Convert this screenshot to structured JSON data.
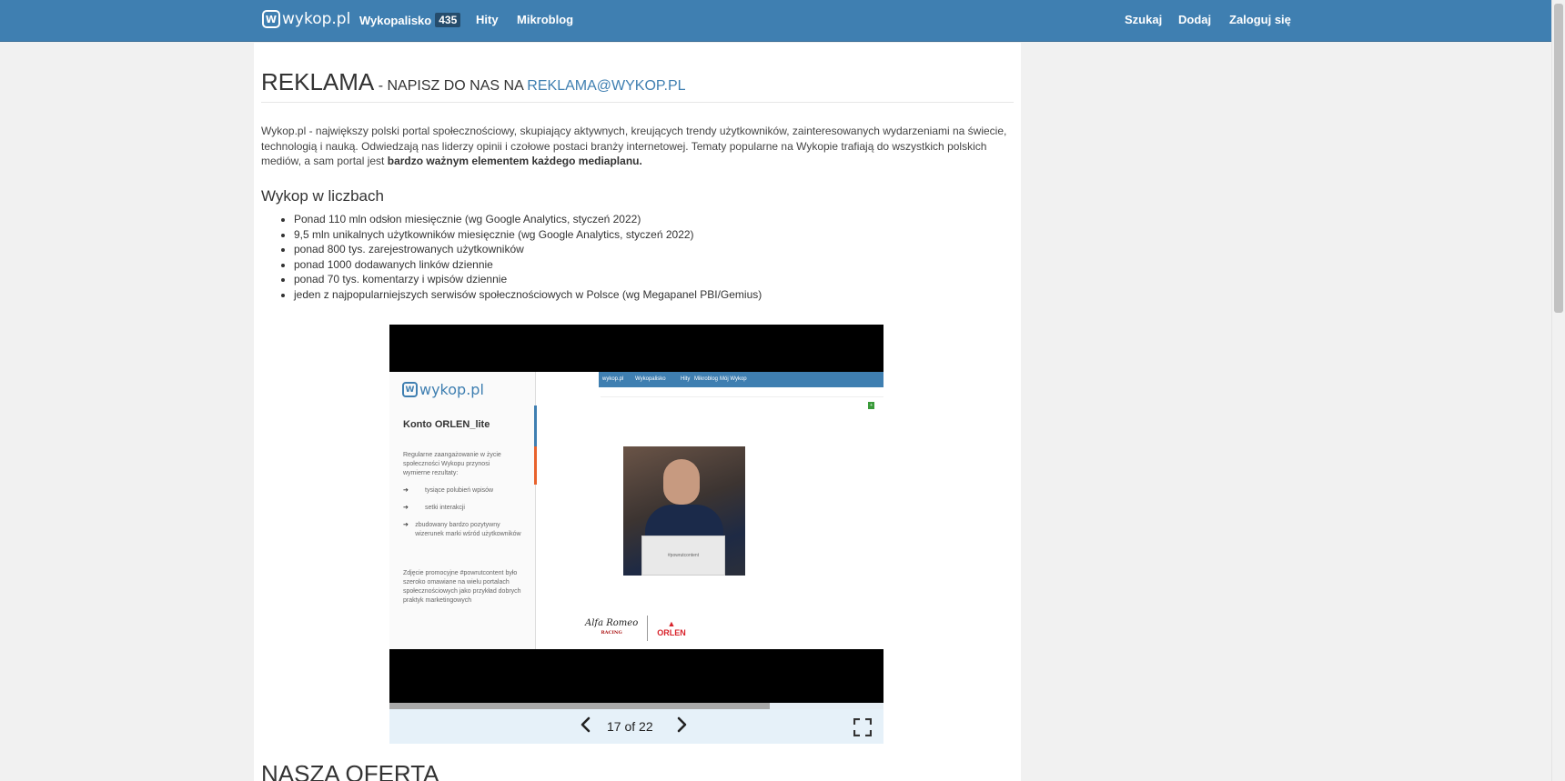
{
  "header": {
    "logo_text": "wykop.pl",
    "logo_mark": "W",
    "nav": {
      "wykopalisko": "Wykopalisko",
      "wykopalisko_count": "435",
      "hity": "Hity",
      "mikroblog": "Mikroblog",
      "szukaj": "Szukaj",
      "dodaj": "Dodaj",
      "zaloguj": "Zaloguj się"
    }
  },
  "page": {
    "title_main": "REKLAMA",
    "title_sub": " - NAPISZ DO NAS NA ",
    "title_email": "REKLAMA@WYKOP.PL",
    "intro_text": "Wykop.pl - największy polski portal społecznościowy, skupiający aktywnych, kreujących trendy użytkowników, zainteresowanych wydarzeniami na świecie, technologią i nauką. Odwiedzają nas liderzy opinii i czołowe postaci branży internetowej. Tematy popularne na Wykopie trafiają do wszystkich polskich mediów, a sam portal jest ",
    "intro_bold": "bardzo ważnym elementem każdego mediaplanu.",
    "stats_heading": "Wykop w liczbach",
    "stats": [
      "Ponad 110 mln odsłon miesięcznie (wg Google Analytics, styczeń 2022)",
      "9,5 mln unikalnych użytkowników miesięcznie (wg Google Analytics, styczeń 2022)",
      "ponad 800 tys. zarejestrowanych użytkowników",
      "ponad 1000 dodawanych linków dziennie",
      "ponad 70 tys. komentarzy i wpisów dziennie",
      "jeden z najpopularniejszych serwisów społecznościowych w Polsce (wg Megapanel PBI/Gemius)"
    ],
    "offer_heading": "NASZA OFERTA"
  },
  "slideshow": {
    "current": 17,
    "total": 22,
    "counter_text": "17 of 22",
    "progress_fraction": 0.77,
    "prev_icon": "chevron-left-icon",
    "next_icon": "chevron-right-icon",
    "fullscreen_icon": "fullscreen-icon",
    "slide": {
      "logo_text": "wykop.pl",
      "title": "Konto ORLEN_lite",
      "description": "Regularne zaangażowanie w życie społeczności Wykopu przynosi wymierne rezultaty:",
      "bullets": [
        "tysiące polubień wpisów",
        "setki interakcji",
        "zbudowany bardzo pozytywny wizerunek marki wśród użytkowników"
      ],
      "footer_text": "Zdjęcie promocyjne #powrutcontent było szeroko omawiane na wielu portalach społecznościowych jako przykład dobrych praktyk marketingowych",
      "bar_items": [
        "wykop.pl",
        "Wykopalisko",
        "Hity",
        "Mikroblog",
        "Mój Wykop"
      ],
      "photo_card_text": "#powrutcontent",
      "brand_alfa": "Alfa Romeo",
      "brand_racing": "RACING",
      "brand_orlen": "ORLEN"
    }
  },
  "colors": {
    "brand_blue": "#3f7fb1",
    "orlen_red": "#d8222a"
  }
}
